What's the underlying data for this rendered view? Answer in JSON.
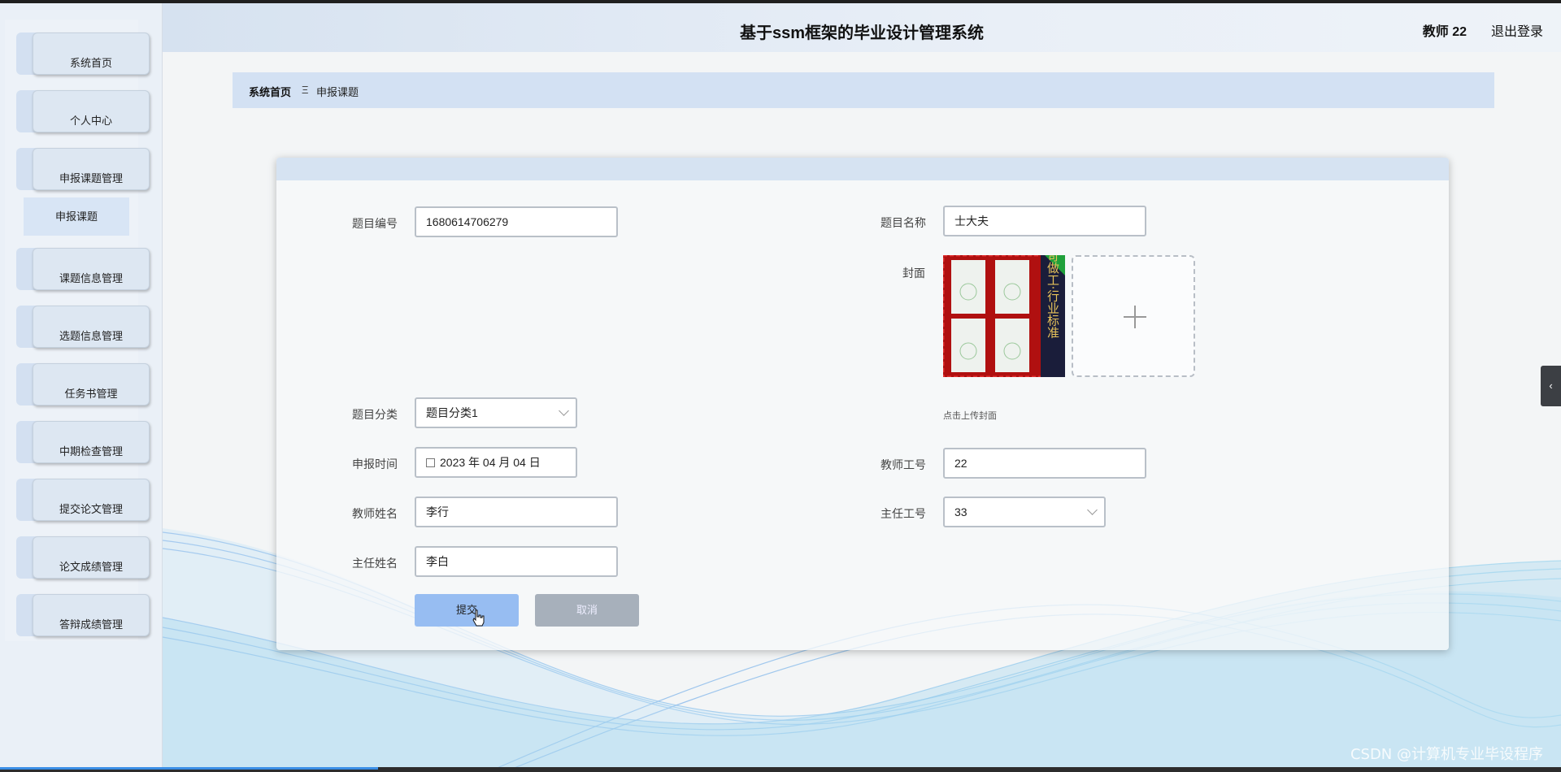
{
  "header": {
    "title": "基于ssm框架的毕业设计管理系统",
    "user": "教师 22",
    "logout": "退出登录"
  },
  "sidebar": {
    "items": [
      {
        "label": "系统首页"
      },
      {
        "label": "个人中心"
      },
      {
        "label": "申报课题管理"
      },
      {
        "label": "课题信息管理"
      },
      {
        "label": "选题信息管理"
      },
      {
        "label": "任务书管理"
      },
      {
        "label": "中期检查管理"
      },
      {
        "label": "提交论文管理"
      },
      {
        "label": "论文成绩管理"
      },
      {
        "label": "答辩成绩管理"
      }
    ],
    "submenu": "申报课题"
  },
  "breadcrumb": {
    "home": "系统首页",
    "separator": "Ξ",
    "current": "申报课题"
  },
  "form": {
    "topic_no": {
      "label": "题目编号",
      "value": "1680614706279"
    },
    "topic_name": {
      "label": "题目名称",
      "value": "士大夫"
    },
    "cover": {
      "label": "封面",
      "hint": "点击上传封面",
      "image_text": "严苛做工·行业标准"
    },
    "category": {
      "label": "题目分类",
      "value": "题目分类1"
    },
    "apply_time": {
      "label": "申报时间",
      "value": "2023 年 04 月 04 日"
    },
    "teacher_no": {
      "label": "教师工号",
      "value": "22"
    },
    "teacher_name": {
      "label": "教师姓名",
      "value": "李行"
    },
    "director_no": {
      "label": "主任工号",
      "value": "33"
    },
    "director_name": {
      "label": "主任姓名",
      "value": "李白"
    },
    "submit": "提交",
    "cancel": "取消"
  },
  "side_toggle": "‹",
  "watermark": "CSDN @计算机专业毕设程序",
  "colors": {
    "accent": "#97bdf2",
    "header_bg": "#d6e2f0",
    "cancel": "#a7b0bb"
  }
}
